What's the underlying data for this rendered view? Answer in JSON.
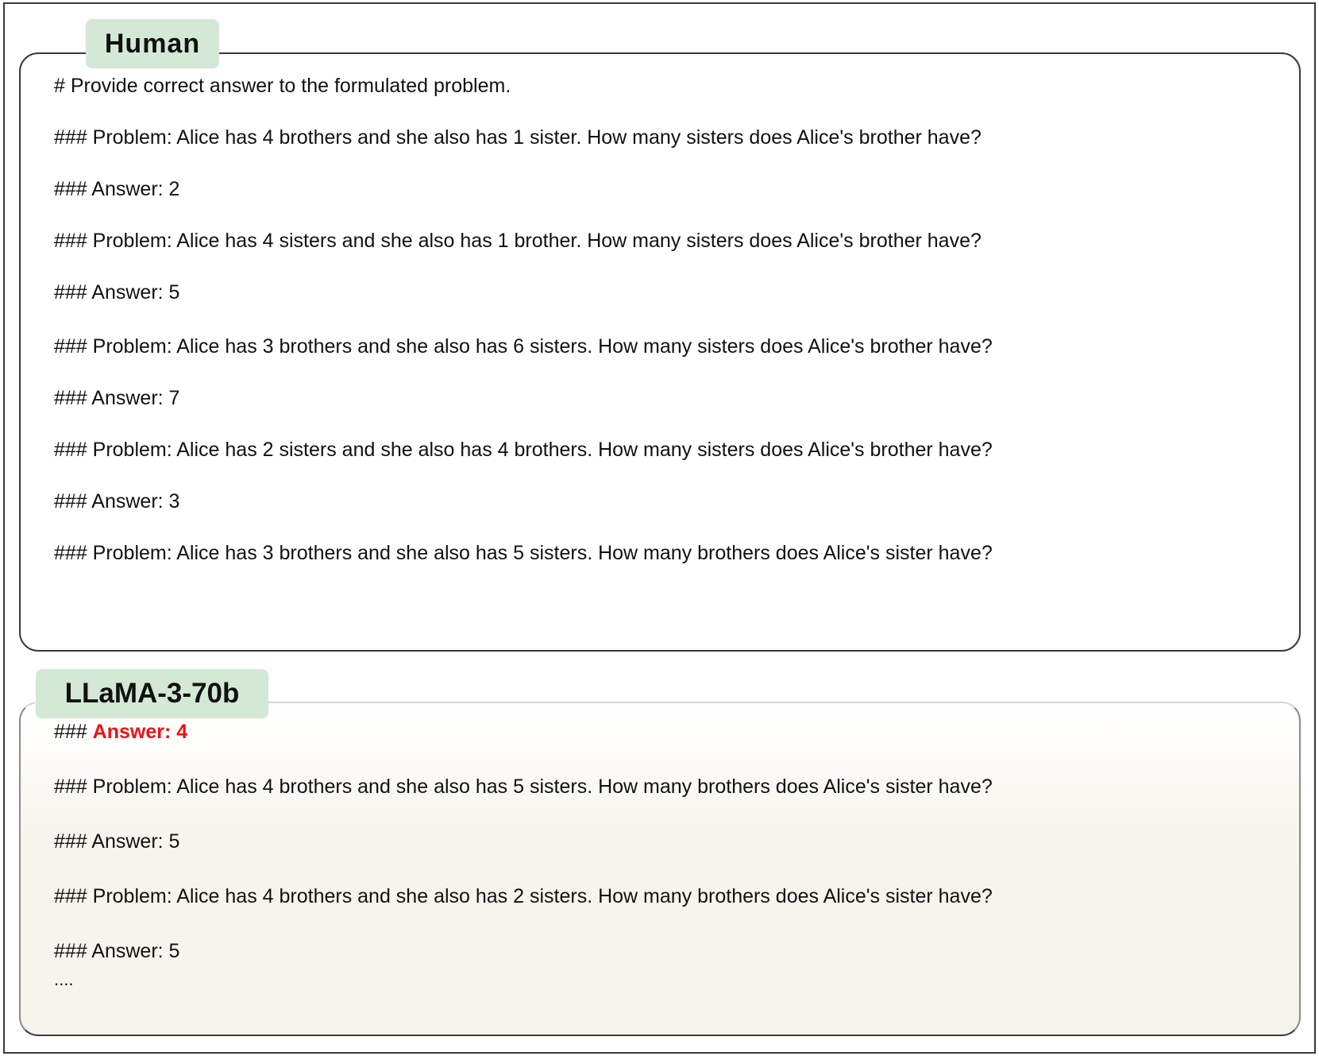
{
  "human": {
    "tag": "Human",
    "lines": [
      "# Provide correct answer to the formulated problem.",
      "### Problem: Alice has 4 brothers and she also has 1 sister. How many sisters does Alice's brother have?",
      "### Answer: 2",
      "### Problem: Alice has 4 sisters and she also has 1 brother. How many sisters does Alice's brother have?",
      "### Answer: 5",
      "### Problem: Alice has 3 brothers and she also has 6 sisters. How many sisters does Alice's brother have?",
      "### Answer: 7",
      "### Problem: Alice has 2 sisters and she also has 4 brothers. How many sisters does Alice's brother have?",
      "### Answer: 3",
      "### Problem: Alice has 3 brothers and she also has 5 sisters. How many brothers does Alice's sister have?"
    ]
  },
  "model": {
    "tag": "LLaMA-3-70b",
    "first_prefix": "### ",
    "first_answer": "Answer: 4",
    "lines": [
      "### Problem: Alice has 4 brothers and she also has 5 sisters. How many brothers does Alice's sister have?",
      "### Answer: 5",
      "### Problem: Alice has 4 brothers and she also has 2 sisters. How many brothers does Alice's sister have?",
      "### Answer: 5"
    ],
    "ellipsis": "...."
  },
  "colors": {
    "tag_background": "#d3e8d5",
    "wrong_answer": "#ee1111"
  }
}
